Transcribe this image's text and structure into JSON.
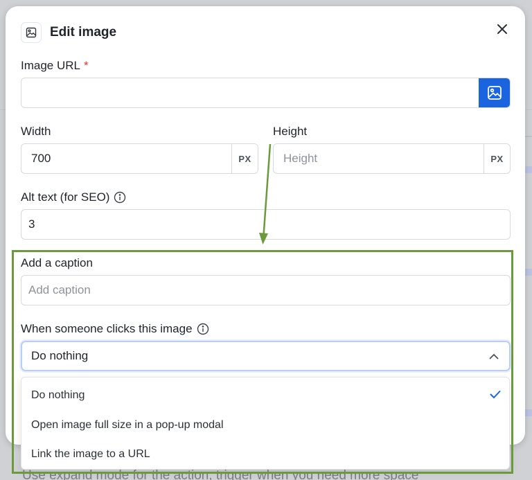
{
  "modal": {
    "title": "Edit image",
    "header_icon": "image-icon",
    "close_icon": "close-icon"
  },
  "image_url": {
    "label": "Image URL",
    "required_mark": "*",
    "value": "",
    "placeholder": "",
    "browse_icon": "image-icon"
  },
  "width": {
    "label": "Width",
    "value": "700",
    "unit": "PX"
  },
  "height": {
    "label": "Height",
    "value": "",
    "placeholder": "Height",
    "unit": "PX"
  },
  "alt_text": {
    "label": "Alt text (for SEO)",
    "info_icon": "info-icon",
    "value": "3"
  },
  "caption": {
    "label": "Add a caption",
    "value": "",
    "placeholder": "Add caption"
  },
  "click_action": {
    "label": "When someone clicks this image",
    "info_icon": "info-icon",
    "selected": "Do nothing",
    "expanded": true,
    "options": [
      {
        "label": "Do nothing",
        "selected": true
      },
      {
        "label": "Open image full size in a pop-up modal",
        "selected": false
      },
      {
        "label": "Link the image to a URL",
        "selected": false
      }
    ]
  },
  "background": {
    "footer_text": "Use expand mode for the action, trigger when you need more space"
  },
  "colors": {
    "accent": "#1a64e0",
    "required": "#e5372b",
    "annotation": "#6a9a3a"
  }
}
